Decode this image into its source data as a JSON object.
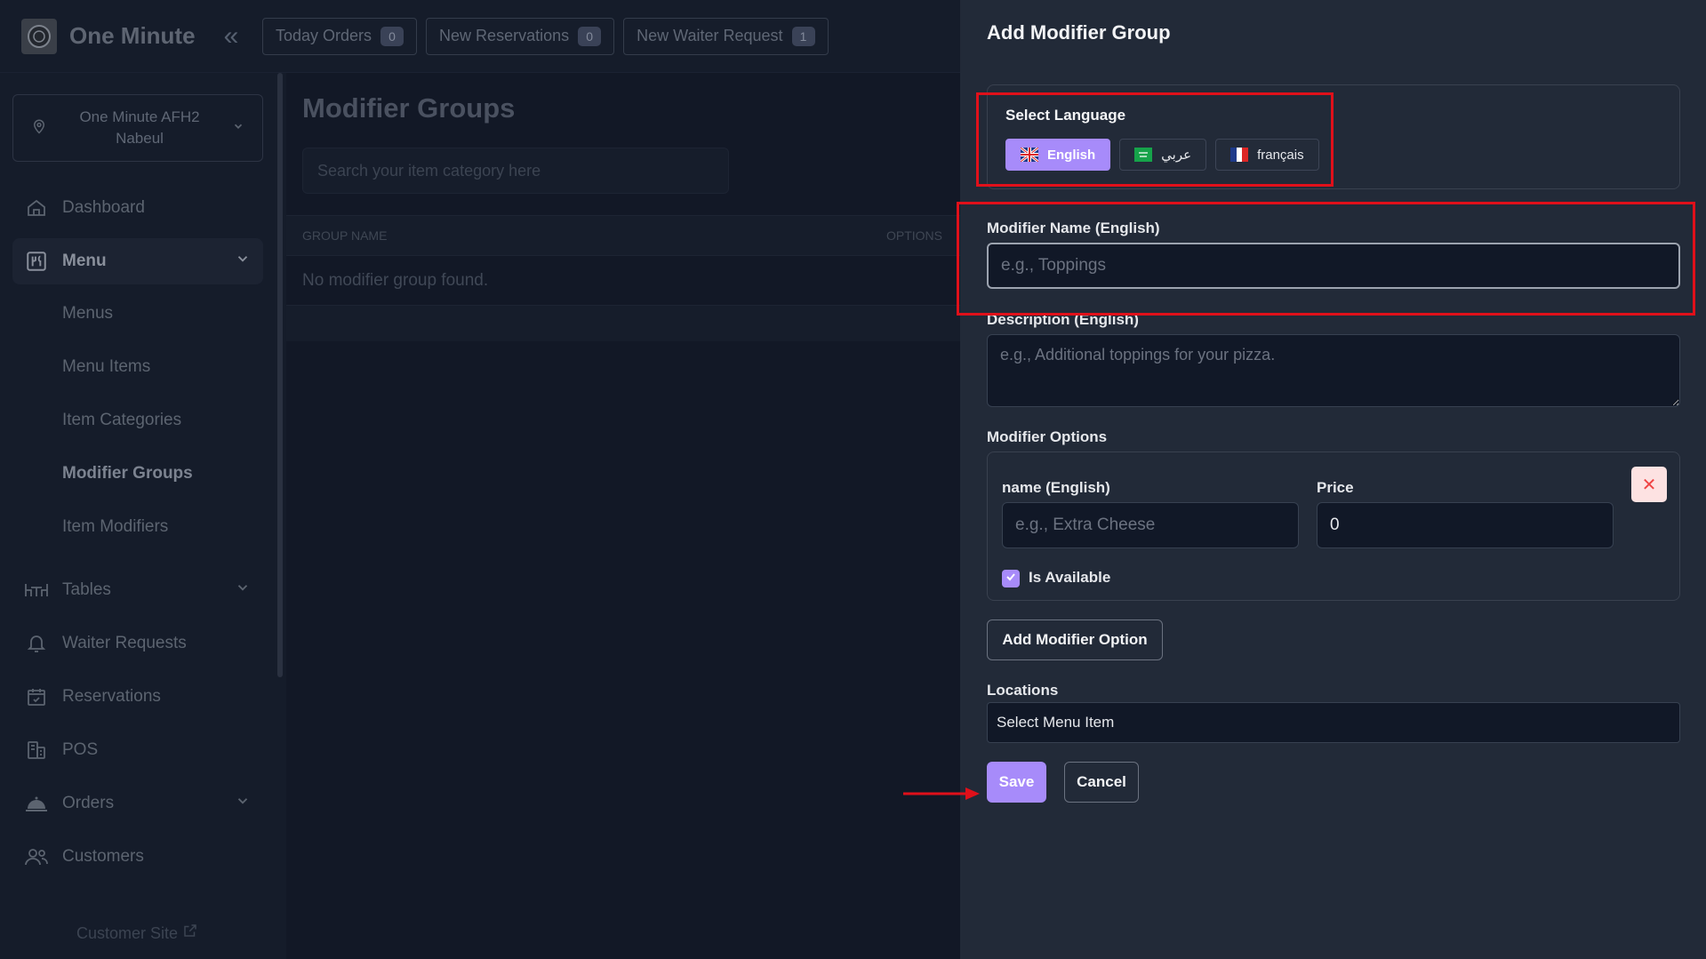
{
  "header": {
    "brand": "One Minute",
    "pills": [
      {
        "label": "Today Orders",
        "count": "0"
      },
      {
        "label": "New Reservations",
        "count": "0"
      },
      {
        "label": "New Waiter Request",
        "count": "1"
      }
    ]
  },
  "sidebar": {
    "location_line1": "One Minute AFH2",
    "location_line2": "Nabeul",
    "items": {
      "dashboard": "Dashboard",
      "menu": "Menu",
      "tables": "Tables",
      "waiter_requests": "Waiter Requests",
      "reservations": "Reservations",
      "pos": "POS",
      "orders": "Orders",
      "customers": "Customers"
    },
    "menu_sub": {
      "menus": "Menus",
      "menu_items": "Menu Items",
      "item_categories": "Item Categories",
      "modifier_groups": "Modifier Groups",
      "item_modifiers": "Item Modifiers"
    },
    "customer_site": "Customer Site"
  },
  "main": {
    "title": "Modifier Groups",
    "search_placeholder": "Search your item category here",
    "columns": {
      "group_name": "GROUP NAME",
      "options": "OPTIONS"
    },
    "empty_text": "No modifier group found."
  },
  "drawer": {
    "title": "Add Modifier Group",
    "select_language_label": "Select Language",
    "languages": {
      "english": "English",
      "arabic": "عربي",
      "french": "français"
    },
    "modifier_name_label": "Modifier Name (English)",
    "modifier_name_placeholder": "e.g., Toppings",
    "description_label": "Description (English)",
    "description_placeholder": "e.g., Additional toppings for your pizza.",
    "modifier_options_label": "Modifier Options",
    "option_name_label": "name (English)",
    "option_name_placeholder": "e.g., Extra Cheese",
    "price_label": "Price",
    "price_value": "0",
    "is_available_label": "Is Available",
    "add_option_label": "Add Modifier Option",
    "locations_label": "Locations",
    "locations_value": "Select Menu Item",
    "save_label": "Save",
    "cancel_label": "Cancel"
  },
  "colors": {
    "accent": "#a78bfa",
    "annotation": "#e0101a",
    "drawer_bg": "#222a38",
    "page_bg": "#151c2a"
  }
}
